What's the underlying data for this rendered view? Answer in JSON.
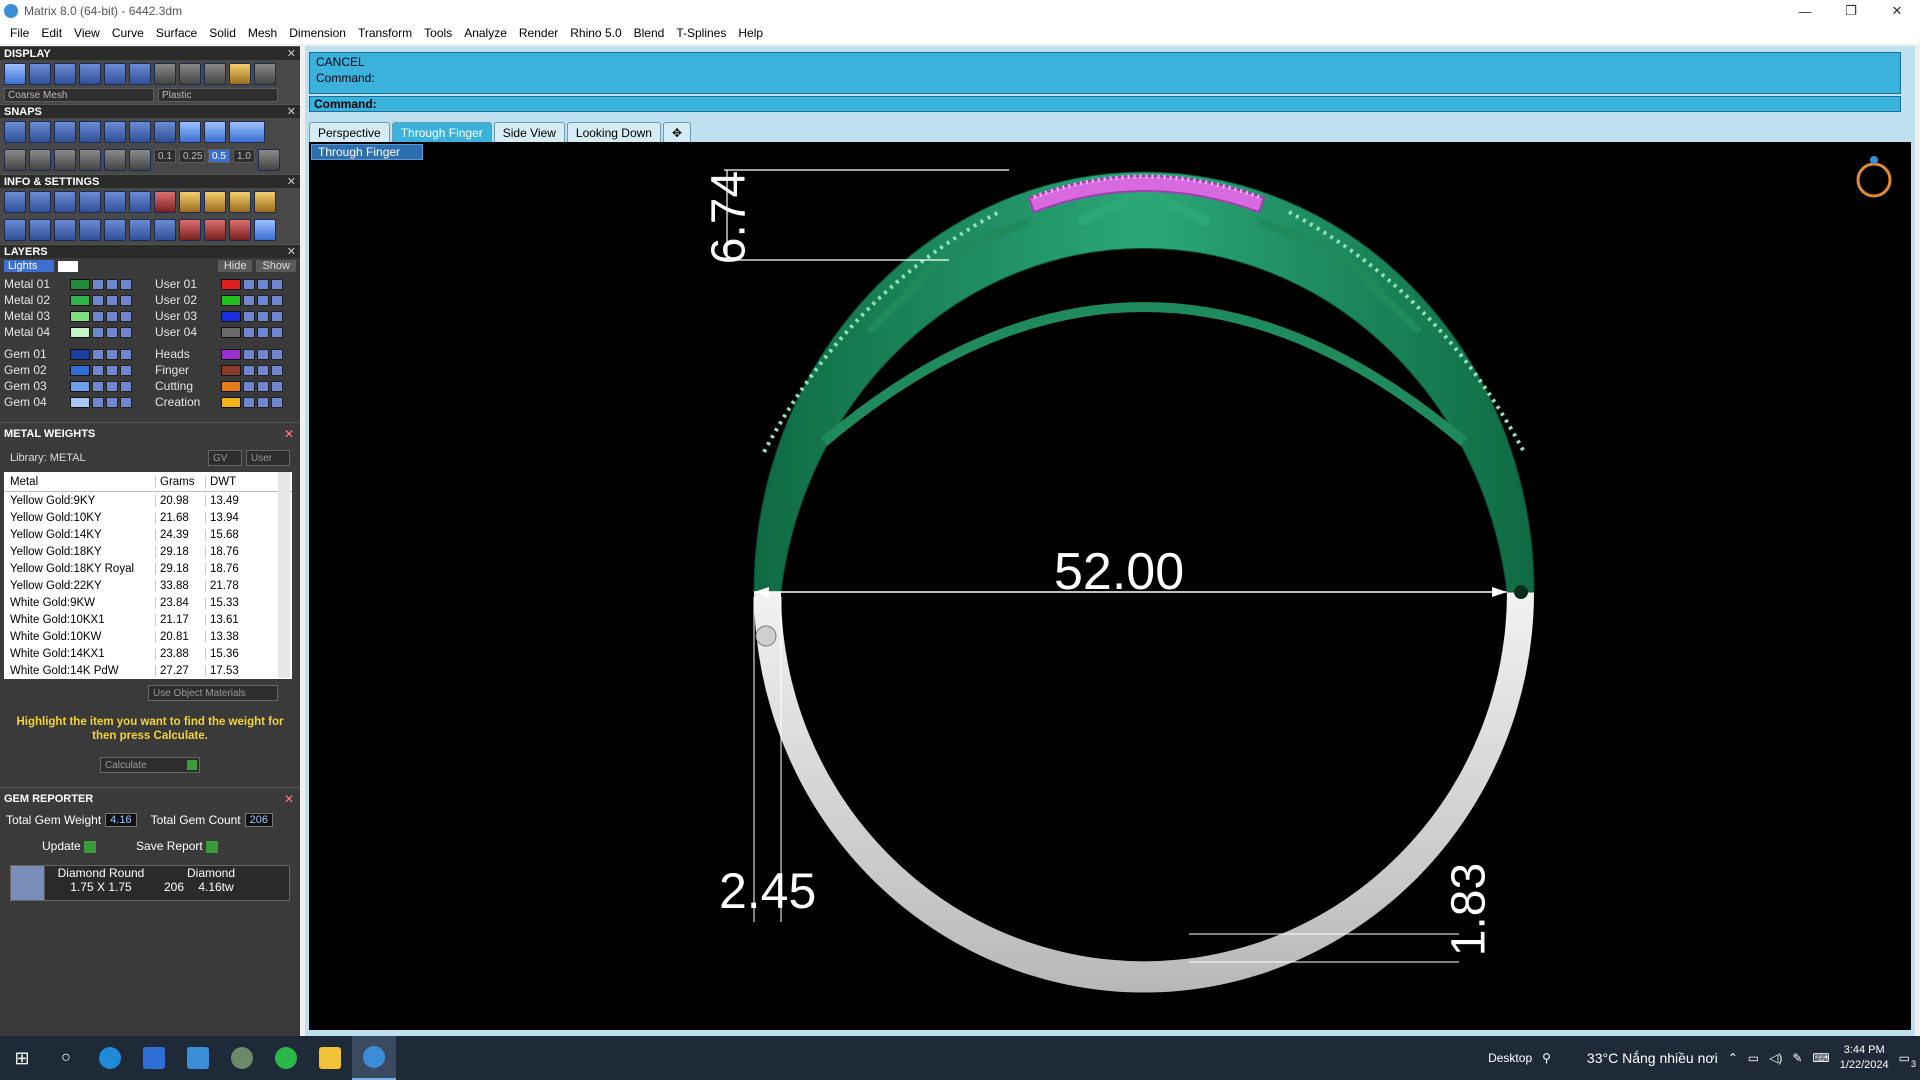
{
  "window": {
    "title": "Matrix 8.0 (64-bit) - 6442.3dm"
  },
  "menu": [
    "File",
    "Edit",
    "View",
    "Curve",
    "Surface",
    "Solid",
    "Mesh",
    "Dimension",
    "Transform",
    "Tools",
    "Analyze",
    "Render",
    "Rhino 5.0",
    "Blend",
    "T-Splines",
    "Help"
  ],
  "display": {
    "title": "DISPLAY",
    "mesh_combo": "Coarse Mesh",
    "material_combo": "Plastic"
  },
  "snaps": {
    "title": "SNAPS",
    "values": [
      "0.1",
      "0.25",
      "0.5",
      "1.0"
    ]
  },
  "info": {
    "title": "INFO & SETTINGS"
  },
  "layers": {
    "title": "LAYERS",
    "lights": "Lights",
    "hide": "Hide",
    "show": "Show",
    "left": [
      {
        "name": "Metal 01",
        "color": "#1e8a3a"
      },
      {
        "name": "Metal 02",
        "color": "#2fb24a"
      },
      {
        "name": "Metal 03",
        "color": "#7fe07f"
      },
      {
        "name": "Metal 04",
        "color": "#c8f5c8"
      },
      {
        "name": "Gem 01",
        "color": "#1a3f9c"
      },
      {
        "name": "Gem 02",
        "color": "#2f6fd6"
      },
      {
        "name": "Gem 03",
        "color": "#6f9fe8"
      },
      {
        "name": "Gem 04",
        "color": "#a9c6f2"
      }
    ],
    "right": [
      {
        "name": "User 01",
        "color": "#e02020"
      },
      {
        "name": "User 02",
        "color": "#20c020"
      },
      {
        "name": "User 03",
        "color": "#1a2fe0"
      },
      {
        "name": "User 04",
        "color": "#6a6a6a"
      },
      {
        "name": "Heads",
        "color": "#9a2fd0"
      },
      {
        "name": "Finger",
        "color": "#8a3a2a"
      },
      {
        "name": "Cutting",
        "color": "#e67a1a"
      },
      {
        "name": "Creation",
        "color": "#f2b21a"
      }
    ]
  },
  "metal_weights": {
    "title": "METAL WEIGHTS",
    "library": "Library: METAL",
    "gv": "GV",
    "user": "User",
    "headers": [
      "Metal",
      "Grams",
      "DWT"
    ],
    "rows": [
      [
        "Yellow Gold:9KY",
        "20.98",
        "13.49"
      ],
      [
        "Yellow Gold:10KY",
        "21.68",
        "13.94"
      ],
      [
        "Yellow Gold:14KY",
        "24.39",
        "15.68"
      ],
      [
        "Yellow Gold:18KY",
        "29.18",
        "18.76"
      ],
      [
        "Yellow Gold:18KY Royal",
        "29.18",
        "18.76"
      ],
      [
        "Yellow Gold:22KY",
        "33.88",
        "21.78"
      ],
      [
        "White Gold:9KW",
        "23.84",
        "15.33"
      ],
      [
        "White Gold:10KX1",
        "21.17",
        "13.61"
      ],
      [
        "White Gold:10KW",
        "20.81",
        "13.38"
      ],
      [
        "White Gold:14KX1",
        "23.88",
        "15.36"
      ],
      [
        "White Gold:14K PdW",
        "27.27",
        "17.53"
      ]
    ],
    "use_object_materials": "Use Object Materials",
    "hint": "Highlight the item you want to find the weight for then press Calculate.",
    "calculate": "Calculate"
  },
  "gem_reporter": {
    "title": "GEM REPORTER",
    "total_weight_label": "Total Gem Weight",
    "total_weight": "4.16",
    "total_count_label": "Total Gem Count",
    "total_count": "206",
    "update": "Update",
    "save_report": "Save Report",
    "gem": {
      "shape": "Diamond Round",
      "size": "1.75 X 1.75",
      "material": "Diamond",
      "count": "206",
      "weight": "4.16tw"
    }
  },
  "command": {
    "line1": "CANCEL",
    "line2": "Command:",
    "prompt": "Command:"
  },
  "tabs": [
    "Perspective",
    "Through Finger",
    "Side View",
    "Looking Down"
  ],
  "active_tab": "Through Finger",
  "view_combo": "Through Finger",
  "dimensions": {
    "top_height": "6.74",
    "diameter": "52.00",
    "left_thickness": "2.45",
    "bottom_thickness": "1.83"
  },
  "colors": {
    "metal": "#1f8a5c",
    "gems": "#d86ae0",
    "cmd": "#3ab2dc",
    "hint": "#f3d338"
  },
  "taskbar": {
    "desktop": "Desktop",
    "weather": "33°C  Nắng nhiều nơi",
    "time": "3:44 PM",
    "date": "1/22/2024",
    "notifications": "3"
  }
}
